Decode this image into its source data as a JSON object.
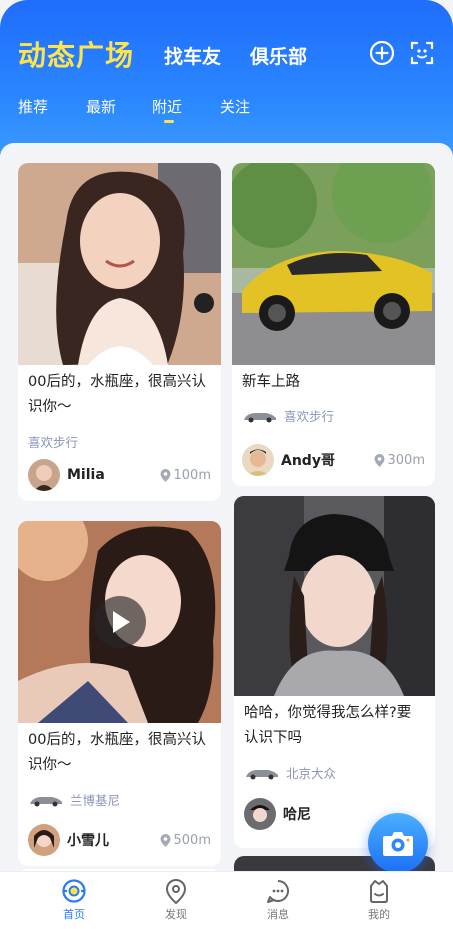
{
  "header": {
    "title": "动态广场",
    "tabs": [
      "找车友",
      "俱乐部"
    ],
    "icons": [
      "add-circle-icon",
      "scan-icon"
    ],
    "subtabs": [
      "推荐",
      "最新",
      "附近",
      "关注"
    ],
    "active_subtab": "附近"
  },
  "colors": {
    "accent": "#2a7af6",
    "title": "#ffe34a",
    "tag": "#8a96b8"
  },
  "posts": [
    {
      "text": "00后的，水瓶座，很高兴认识你～",
      "tag": "喜欢步行",
      "author": "Milia",
      "distance": "100m",
      "has_car_icon": false,
      "video": false
    },
    {
      "text": "新车上路",
      "tag": "喜欢步行",
      "author": "Andy哥",
      "distance": "300m",
      "has_car_icon": true,
      "video": false
    },
    {
      "text": "00后的，水瓶座，很高兴认识你～",
      "tag": "兰博基尼",
      "author": "小雪儿",
      "distance": "500m",
      "has_car_icon": true,
      "video": true
    },
    {
      "text": "哈哈，你觉得我怎么样?要认识下吗",
      "tag": "北京大众",
      "author": "哈尼",
      "distance": "",
      "has_car_icon": true,
      "video": false
    }
  ],
  "tabbar": {
    "items": [
      {
        "label": "首页",
        "icon": "home-icon",
        "active": true
      },
      {
        "label": "发现",
        "icon": "location-icon",
        "active": false
      },
      {
        "label": "消息",
        "icon": "message-icon",
        "active": false
      },
      {
        "label": "我的",
        "icon": "profile-icon",
        "active": false
      }
    ]
  }
}
